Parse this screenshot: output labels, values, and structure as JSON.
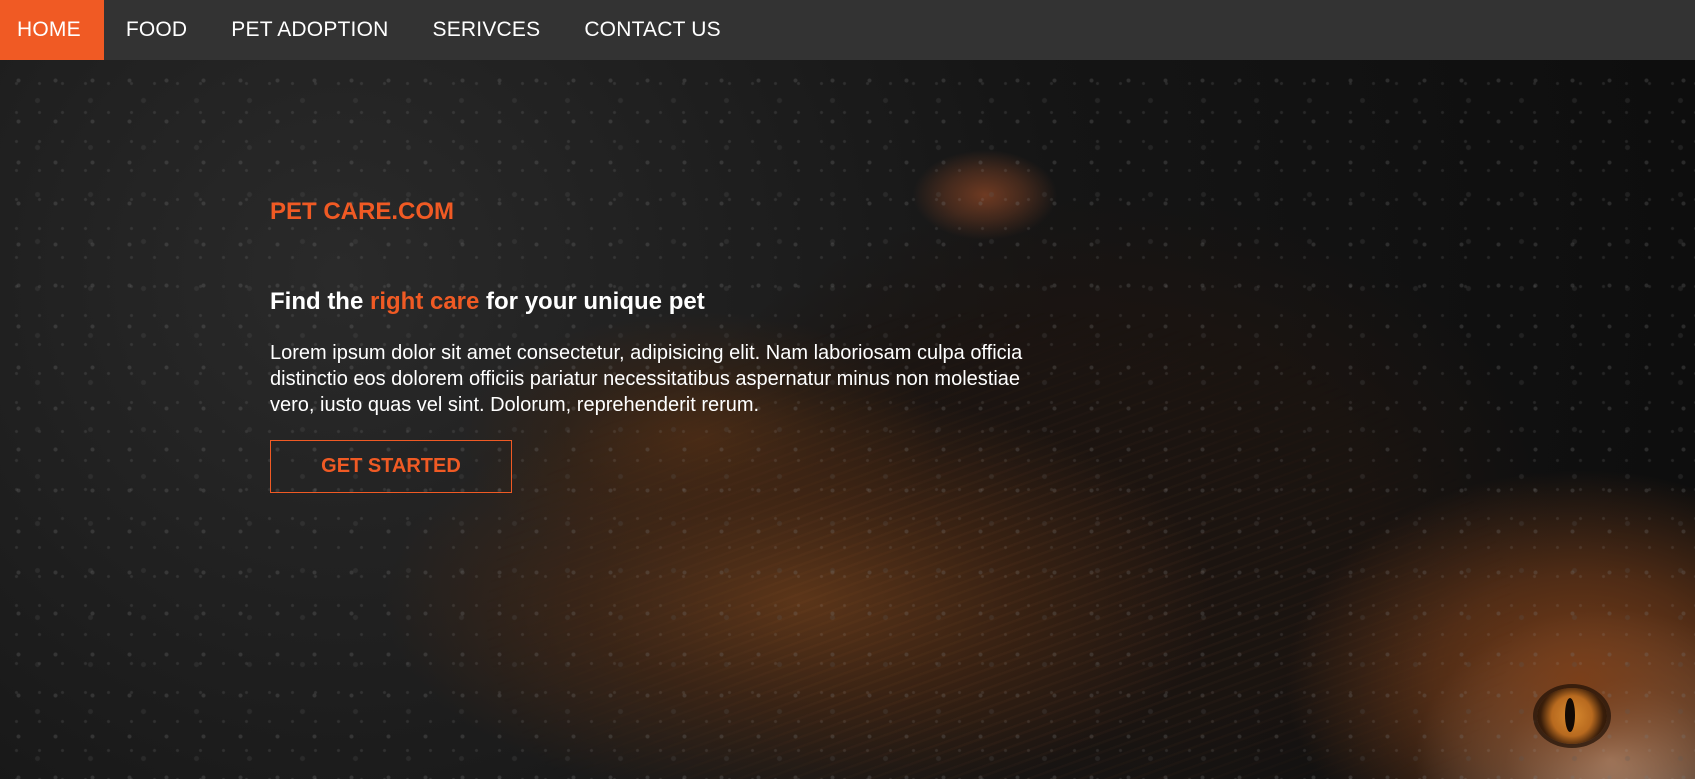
{
  "nav": {
    "items": [
      {
        "label": "HOME",
        "active": true
      },
      {
        "label": "FOOD",
        "active": false
      },
      {
        "label": "PET ADOPTION",
        "active": false
      },
      {
        "label": "SERIVCES",
        "active": false
      },
      {
        "label": "CONTACT US",
        "active": false
      }
    ]
  },
  "hero": {
    "brand": "PET CARE.COM",
    "headline": {
      "before": "Find the ",
      "accent": "right care",
      "after": " for your unique pet"
    },
    "lead": "Lorem ipsum dolor sit amet consectetur, adipisicing elit. Nam laboriosam culpa officia distinctio eos dolorem officiis pariatur necessitatibus aspernatur minus non molestiae vero, iusto quas vel sint. Dolorum, reprehenderit rerum.",
    "cta_label": "GET STARTED",
    "background_image": "calico-cat-on-asphalt"
  },
  "colors": {
    "accent": "#f05a24",
    "navbar": "#333333",
    "text": "#ffffff"
  }
}
